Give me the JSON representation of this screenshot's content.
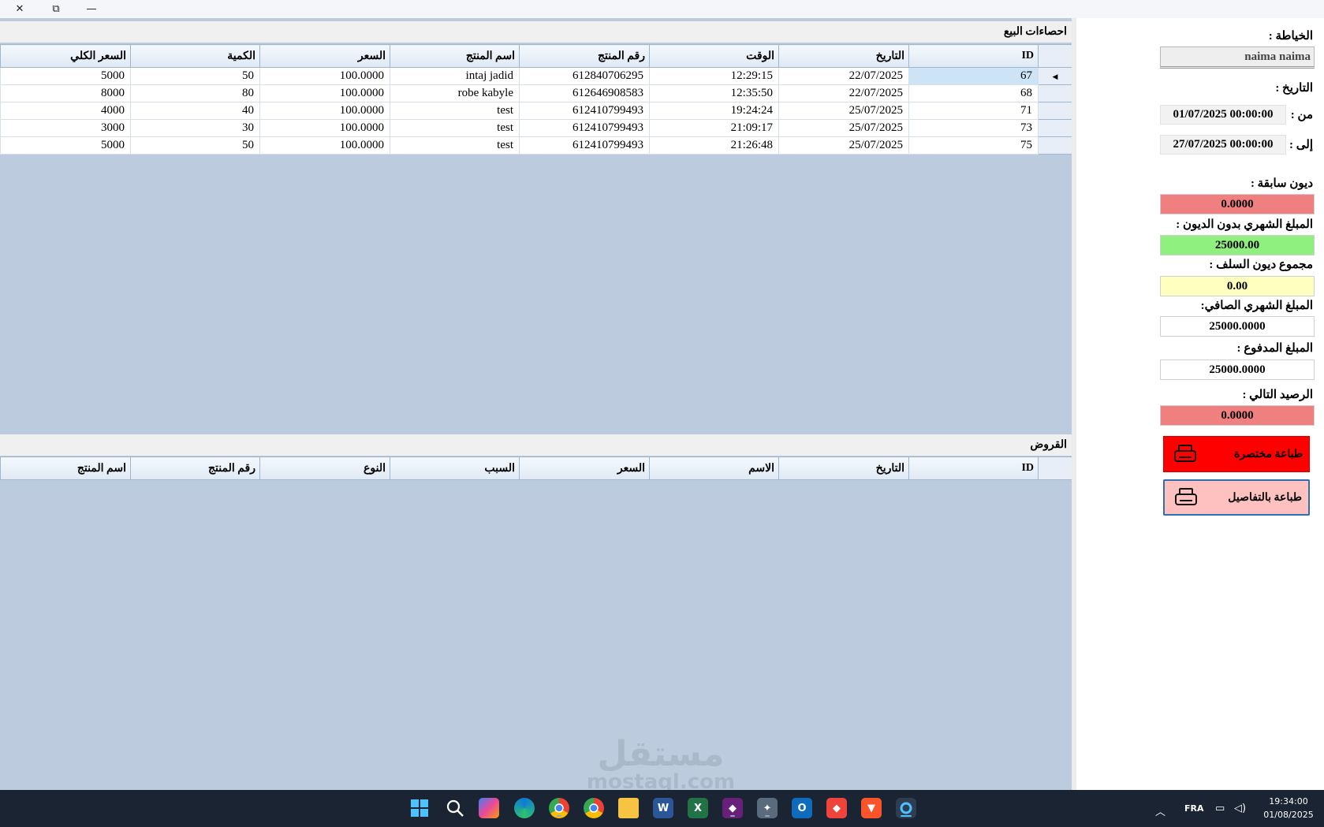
{
  "window": {
    "close_glyph": "✕",
    "restore_glyph": "⧉",
    "minimize_glyph": "—"
  },
  "sales": {
    "title": "احصاءات البيع",
    "columns": [
      "ID",
      "التاريخ",
      "الوقت",
      "رقم المنتج",
      "اسم المنتج",
      "السعر",
      "الكمية",
      "السعر الكلي"
    ],
    "rows": [
      [
        "67",
        "22/07/2025",
        "12:29:15",
        "612840706295",
        "intaj jadid",
        "100.0000",
        "50",
        "5000"
      ],
      [
        "68",
        "22/07/2025",
        "12:35:50",
        "612646908583",
        "robe kabyle",
        "100.0000",
        "80",
        "8000"
      ],
      [
        "71",
        "25/07/2025",
        "19:24:24",
        "612410799493",
        "test",
        "100.0000",
        "40",
        "4000"
      ],
      [
        "73",
        "25/07/2025",
        "21:09:17",
        "612410799493",
        "test",
        "100.0000",
        "30",
        "3000"
      ],
      [
        "75",
        "25/07/2025",
        "21:26:48",
        "612410799493",
        "test",
        "100.0000",
        "50",
        "5000"
      ]
    ]
  },
  "loans": {
    "title": "القروض",
    "columns": [
      "ID",
      "التاريخ",
      "الاسم",
      "السعر",
      "السبب",
      "النوع",
      "رقم المنتج",
      "اسم المنتج"
    ]
  },
  "panel": {
    "tailor_label": "الخياطة :",
    "tailor_value": "naima naima",
    "date_label": "التاريخ :",
    "from_label": "من :",
    "from_value": "01/07/2025 00:00:00",
    "to_label": "إلى :",
    "to_value": "27/07/2025 00:00:00",
    "prev_debts_label": "ديون سابقة :",
    "prev_debts_value": "0.0000",
    "monthly_no_debt_label": "المبلغ الشهري بدون الديون :",
    "monthly_no_debt_value": "25000.00",
    "advance_debts_label": "مجموع ديون السلف :",
    "advance_debts_value": "0.00",
    "net_monthly_label": "المبلغ الشهري الصافي:",
    "net_monthly_value": "25000.0000",
    "paid_label": "المبلغ المدفوع :",
    "paid_value": "25000.0000",
    "next_balance_label": "الرصيد التالي :",
    "next_balance_value": "0.0000",
    "print_short_label": "طباعة مختصرة",
    "print_detailed_label": "طباعة بالتفاصيل"
  },
  "colors": {
    "red_field": "#f08080",
    "green_field": "#8ff07f",
    "yellow_field": "#ffffc0",
    "print_short_bg": "#ff0000",
    "print_detailed_bg": "#ffc0c0"
  },
  "taskbar": {
    "icons": [
      "start-icon",
      "search-icon",
      "copilot-icon",
      "edge-icon",
      "chrome-icon",
      "chrome-icon",
      "file-explorer-icon",
      "word-icon",
      "excel-icon",
      "visual-studio-icon",
      "tools-icon",
      "outlook-icon",
      "anydesk-icon",
      "brave-icon",
      "app-icon"
    ],
    "language": "FRA",
    "time": "19:34:00",
    "date": "01/08/2025"
  },
  "watermark": {
    "arabic": "مستقل",
    "latin": "mostaql.com"
  }
}
